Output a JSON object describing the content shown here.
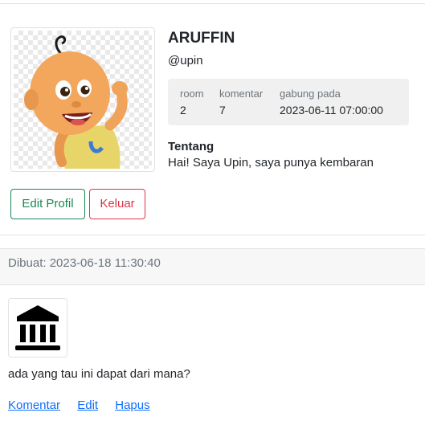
{
  "profile": {
    "name": "ARUFFIN",
    "username": "@upin",
    "stats": [
      {
        "label": "room",
        "value": "2"
      },
      {
        "label": "komentar",
        "value": "7"
      },
      {
        "label": "gabung pada",
        "value": "2023-06-11 07:00:00"
      }
    ],
    "about_title": "Tentang",
    "about_text": "Hai! Saya Upin, saya punya kembaran",
    "edit_label": "Edit Profil",
    "logout_label": "Keluar"
  },
  "post": {
    "created": "Dibuat: 2023-06-18 11:30:40",
    "image_icon": "bank-building-icon",
    "text": "ada yang tau ini dapat dari mana?",
    "links": {
      "comment": "Komentar",
      "edit": "Edit",
      "delete": "Hapus"
    }
  },
  "colors": {
    "edit_button": "#198754",
    "logout_button": "#dc3545",
    "link": "#0d6efd"
  }
}
